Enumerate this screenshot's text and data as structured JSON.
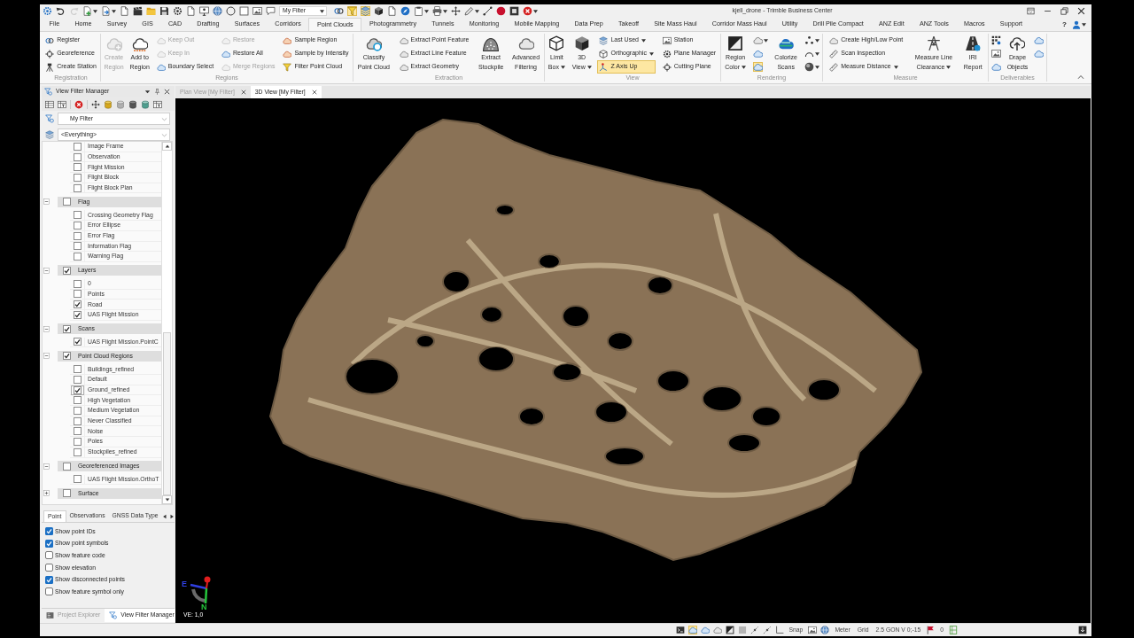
{
  "window": {
    "title": "kjell_drone - Trimble Business Center"
  },
  "quick_access": {
    "tools": [
      {
        "active": false,
        "disabled": false,
        "dropdown": false
      },
      {
        "active": false,
        "disabled": false,
        "dropdown": false
      },
      {
        "active": false,
        "disabled": true,
        "dropdown": false
      },
      {
        "active": false,
        "disabled": false,
        "dropdown": true
      },
      {
        "active": false,
        "disabled": false,
        "dropdown": true
      },
      {
        "active": false,
        "disabled": false,
        "dropdown": false
      },
      {
        "active": false,
        "disabled": false,
        "dropdown": false
      },
      {
        "active": false,
        "disabled": false,
        "dropdown": false
      },
      {
        "active": false,
        "disabled": false,
        "dropdown": false
      },
      {
        "active": false,
        "disabled": false,
        "dropdown": false
      },
      {
        "active": false,
        "disabled": false,
        "dropdown": false
      },
      {
        "active": false,
        "disabled": false,
        "dropdown": false
      },
      {
        "active": false,
        "disabled": false,
        "dropdown": false
      },
      {
        "active": false,
        "disabled": false,
        "dropdown": false
      },
      {
        "active": false,
        "disabled": false,
        "dropdown": false
      },
      {
        "active": false,
        "disabled": false,
        "dropdown": false
      },
      {
        "active": false,
        "disabled": false,
        "dropdown": false
      }
    ],
    "filter": {
      "value": "My Filter"
    },
    "tools_2": [
      {
        "active": false,
        "disabled": false,
        "dropdown": false
      },
      {
        "active": true,
        "disabled": false,
        "dropdown": false
      },
      {
        "active": true,
        "disabled": false,
        "dropdown": false
      },
      {
        "active": false,
        "disabled": false,
        "dropdown": false
      },
      {
        "active": false,
        "disabled": false,
        "dropdown": false
      },
      {
        "active": false,
        "disabled": false,
        "dropdown": false
      },
      {
        "active": false,
        "disabled": false,
        "dropdown": true
      },
      {
        "active": false,
        "disabled": false,
        "dropdown": true
      },
      {
        "active": false,
        "disabled": false,
        "dropdown": false
      },
      {
        "active": false,
        "disabled": false,
        "dropdown": true
      },
      {
        "active": false,
        "disabled": false,
        "dropdown": false
      },
      {
        "active": false,
        "disabled": false,
        "dropdown": false
      },
      {
        "active": false,
        "disabled": false,
        "dropdown": false
      },
      {
        "active": false,
        "disabled": false,
        "dropdown": true
      }
    ]
  },
  "ribbon": {
    "tabs": [
      {
        "label": "File",
        "selected": false
      },
      {
        "label": "Home",
        "selected": false
      },
      {
        "label": "Survey",
        "selected": false
      },
      {
        "label": "GIS",
        "selected": false
      },
      {
        "label": "CAD",
        "selected": false
      },
      {
        "label": "Drafting",
        "selected": false
      },
      {
        "label": "Surfaces",
        "selected": false
      },
      {
        "label": "Corridors",
        "selected": false
      },
      {
        "label": "Point Clouds",
        "selected": true
      },
      {
        "label": "Photogrammetry",
        "selected": false
      },
      {
        "label": "Tunnels",
        "selected": false
      },
      {
        "label": "Monitoring",
        "selected": false
      },
      {
        "label": "Mobile Mapping",
        "selected": false
      },
      {
        "label": "Data Prep",
        "selected": false
      },
      {
        "label": "Takeoff",
        "selected": false
      },
      {
        "label": "Site Mass Haul",
        "selected": false
      },
      {
        "label": "Corridor Mass Haul",
        "selected": false
      },
      {
        "label": "Utility",
        "selected": false
      },
      {
        "label": "Drill Pile Compact",
        "selected": false
      },
      {
        "label": "ANZ Edit",
        "selected": false
      },
      {
        "label": "ANZ Tools",
        "selected": false
      },
      {
        "label": "Macros",
        "selected": false
      },
      {
        "label": "Support",
        "selected": false
      }
    ],
    "help": "?",
    "groups": [
      {
        "label": "Registration",
        "columns": [
          {
            "kind": "stack",
            "items": [
              {
                "label": "Register",
                "disabled": false,
                "active": false,
                "dropdown": false
              },
              {
                "label": "Georeference",
                "disabled": false,
                "active": false,
                "dropdown": false
              },
              {
                "label": "Create Station",
                "disabled": false,
                "active": false,
                "dropdown": false
              }
            ]
          }
        ]
      },
      {
        "label": "Regions",
        "columns": [
          {
            "kind": "large",
            "items": [
              {
                "lines": [
                  "Create",
                  "Region"
                ],
                "disabled": true,
                "active": false,
                "dropdown": false
              }
            ]
          },
          {
            "kind": "large",
            "items": [
              {
                "lines": [
                  "Add to",
                  "Region"
                ],
                "disabled": false,
                "active": false,
                "dropdown": false
              }
            ]
          },
          {
            "kind": "stack",
            "items": [
              {
                "label": "Keep Out",
                "disabled": true,
                "active": false,
                "dropdown": false
              },
              {
                "label": "Keep In",
                "disabled": true,
                "active": false,
                "dropdown": false
              },
              {
                "label": "Boundary Select",
                "disabled": false,
                "active": false,
                "dropdown": false
              }
            ]
          },
          {
            "kind": "stack",
            "items": [
              {
                "label": "Restore",
                "disabled": true,
                "active": false,
                "dropdown": false
              },
              {
                "label": "Restore All",
                "disabled": false,
                "active": false,
                "dropdown": false
              },
              {
                "label": "Merge Regions",
                "disabled": true,
                "active": false,
                "dropdown": false
              }
            ]
          },
          {
            "kind": "stack",
            "items": [
              {
                "label": "Sample Region",
                "disabled": false,
                "active": false,
                "dropdown": false
              },
              {
                "label": "Sample by Intensity",
                "disabled": false,
                "active": false,
                "dropdown": false
              },
              {
                "label": "Filter Point Cloud",
                "disabled": false,
                "active": false,
                "dropdown": false
              }
            ]
          }
        ]
      },
      {
        "label": "Extraction",
        "columns": [
          {
            "kind": "large",
            "items": [
              {
                "lines": [
                  "Classify",
                  "Point Cloud"
                ],
                "disabled": false,
                "active": false,
                "dropdown": false
              }
            ]
          },
          {
            "kind": "stack",
            "items": [
              {
                "label": "Extract Point Feature",
                "disabled": false,
                "active": false,
                "dropdown": false
              },
              {
                "label": "Extract Line Feature",
                "disabled": false,
                "active": false,
                "dropdown": false
              },
              {
                "label": "Extract Geometry",
                "disabled": false,
                "active": false,
                "dropdown": false
              }
            ]
          },
          {
            "kind": "large",
            "items": [
              {
                "lines": [
                  "Extract",
                  "Stockpile"
                ],
                "disabled": false,
                "active": false,
                "dropdown": false
              }
            ]
          },
          {
            "kind": "large",
            "items": [
              {
                "lines": [
                  "Advanced",
                  "Filtering"
                ],
                "disabled": false,
                "active": false,
                "dropdown": false
              }
            ]
          }
        ]
      },
      {
        "label": "View",
        "columns": [
          {
            "kind": "large",
            "items": [
              {
                "lines": [
                  "Limit",
                  "Box"
                ],
                "disabled": false,
                "active": false,
                "dropdown": true
              }
            ]
          },
          {
            "kind": "large",
            "items": [
              {
                "lines": [
                  "3D",
                  "View"
                ],
                "disabled": false,
                "active": false,
                "dropdown": true
              }
            ]
          },
          {
            "kind": "stack",
            "items": [
              {
                "label": "Last Used",
                "disabled": false,
                "active": false,
                "dropdown": true
              },
              {
                "label": "Orthographic",
                "disabled": false,
                "active": false,
                "dropdown": true
              },
              {
                "label": "Z Axis Up",
                "disabled": false,
                "active": true,
                "dropdown": false
              }
            ]
          },
          {
            "kind": "stack",
            "items": [
              {
                "label": "Station",
                "disabled": false,
                "active": false,
                "dropdown": false
              },
              {
                "label": "Plane Manager",
                "disabled": false,
                "active": false,
                "dropdown": false
              },
              {
                "label": "Cutting Plane",
                "disabled": false,
                "active": false,
                "dropdown": false
              }
            ]
          }
        ]
      },
      {
        "label": "Rendering",
        "columns": [
          {
            "kind": "large",
            "items": [
              {
                "lines": [
                  "Region",
                  "Color"
                ],
                "disabled": false,
                "active": false,
                "dropdown": true
              }
            ]
          },
          {
            "kind": "icons",
            "items": [
              {
                "disabled": false,
                "active": false,
                "dropdown": true
              },
              {
                "disabled": false,
                "active": false,
                "dropdown": false
              },
              {
                "disabled": false,
                "active": true,
                "dropdown": false
              }
            ]
          },
          {
            "kind": "large",
            "items": [
              {
                "lines": [
                  "Colorize",
                  "Scans"
                ],
                "disabled": false,
                "active": false,
                "dropdown": false
              }
            ]
          },
          {
            "kind": "icons",
            "items": [
              {
                "disabled": false,
                "active": false,
                "dropdown": true
              },
              {
                "disabled": false,
                "active": false,
                "dropdown": true
              },
              {
                "disabled": false,
                "active": false,
                "dropdown": true
              }
            ]
          }
        ]
      },
      {
        "label": "Measure",
        "columns": [
          {
            "kind": "stack",
            "items": [
              {
                "label": "Create High/Low Point",
                "disabled": false,
                "active": false,
                "dropdown": false
              },
              {
                "label": "Scan Inspection",
                "disabled": false,
                "active": false,
                "dropdown": false
              },
              {
                "label": "Measure Distance",
                "disabled": false,
                "active": false,
                "dropdown": true
              }
            ]
          },
          {
            "kind": "large",
            "items": [
              {
                "lines": [
                  "Measure Line",
                  "Clearance"
                ],
                "disabled": false,
                "active": false,
                "dropdown": true
              }
            ]
          },
          {
            "kind": "large",
            "items": [
              {
                "lines": [
                  "IRI",
                  "Report"
                ],
                "disabled": false,
                "active": false,
                "dropdown": false
              }
            ]
          }
        ]
      },
      {
        "label": "Deliverables",
        "columns": [
          {
            "kind": "icons",
            "items": [
              {
                "disabled": false,
                "active": false,
                "dropdown": false
              },
              {
                "disabled": false,
                "active": false,
                "dropdown": false
              },
              {
                "disabled": false,
                "active": false,
                "dropdown": false
              }
            ]
          },
          {
            "kind": "large",
            "items": [
              {
                "lines": [
                  "Drape",
                  "Objects"
                ],
                "disabled": false,
                "active": false,
                "dropdown": false
              }
            ]
          },
          {
            "kind": "icons",
            "items": [
              {
                "disabled": false,
                "active": false,
                "dropdown": false
              },
              {
                "disabled": false,
                "active": false,
                "dropdown": false
              }
            ]
          }
        ]
      }
    ]
  },
  "left_panel": {
    "title": "View Filter Manager",
    "filter": {
      "value": "My Filter"
    },
    "scope": {
      "value": "<Everything>"
    },
    "tree": [
      {
        "children": [
          {
            "label": "Image Frame",
            "checked": false,
            "focused": false
          },
          {
            "label": "Observation",
            "checked": false,
            "focused": false
          },
          {
            "label": "Flight Mission",
            "checked": false,
            "focused": false
          },
          {
            "label": "Flight Block",
            "checked": false,
            "focused": false
          },
          {
            "label": "Flight Block Plan",
            "checked": false,
            "focused": false
          }
        ]
      },
      {
        "label": "Flag",
        "checked": false,
        "expanded": true,
        "children": [
          {
            "label": "Crossing Geometry Flag",
            "checked": false,
            "focused": false
          },
          {
            "label": "Error Ellipse",
            "checked": false,
            "focused": false
          },
          {
            "label": "Error Flag",
            "checked": false,
            "focused": false
          },
          {
            "label": "Information Flag",
            "checked": false,
            "focused": false
          },
          {
            "label": "Warning Flag",
            "checked": false,
            "focused": false
          }
        ]
      },
      {
        "label": "Layers",
        "checked": true,
        "expanded": true,
        "children": [
          {
            "label": "0",
            "checked": false,
            "focused": false
          },
          {
            "label": "Points",
            "checked": false,
            "focused": false
          },
          {
            "label": "Road",
            "checked": true,
            "focused": false
          },
          {
            "label": "UAS Flight Mission",
            "checked": true,
            "focused": false
          }
        ]
      },
      {
        "label": "Scans",
        "checked": true,
        "expanded": true,
        "children": [
          {
            "label": "UAS Flight Mission.PointC",
            "checked": true,
            "focused": false
          }
        ]
      },
      {
        "label": "Point Cloud Regions",
        "checked": true,
        "expanded": true,
        "children": [
          {
            "label": "Buildings_refined",
            "checked": false,
            "focused": false
          },
          {
            "label": "Default",
            "checked": false,
            "focused": false
          },
          {
            "label": "Ground_refined",
            "checked": true,
            "focused": true
          },
          {
            "label": "High Vegetation",
            "checked": false,
            "focused": false
          },
          {
            "label": "Medium Vegetation",
            "checked": false,
            "focused": false
          },
          {
            "label": "Never Classified",
            "checked": false,
            "focused": false
          },
          {
            "label": "Noise",
            "checked": false,
            "focused": false
          },
          {
            "label": "Poles",
            "checked": false,
            "focused": false
          },
          {
            "label": "Stockpiles_refined",
            "checked": false,
            "focused": false
          }
        ]
      },
      {
        "label": "Georeferenced Images",
        "checked": false,
        "expanded": true,
        "children": [
          {
            "label": "UAS Flight Mission.OrthoT",
            "checked": false,
            "focused": false
          }
        ]
      },
      {
        "label": "Surface",
        "checked": false,
        "expanded": false
      }
    ],
    "tabs": [
      {
        "label": "Point",
        "selected": true
      },
      {
        "label": "Observations",
        "selected": false
      },
      {
        "label": "GNSS Data Type",
        "selected": false
      }
    ],
    "options": [
      {
        "label": "Show point IDs",
        "checked": true
      },
      {
        "label": "Show point symbols",
        "checked": true
      },
      {
        "label": "Show feature code",
        "checked": false
      },
      {
        "label": "Show elevation",
        "checked": false
      },
      {
        "label": "Show disconnected points",
        "checked": true
      },
      {
        "label": "Show feature symbol only",
        "checked": false
      }
    ],
    "bottom_tabs": [
      {
        "label": "Project Explorer",
        "selected": false
      },
      {
        "label": "View Filter Manager",
        "selected": true
      }
    ]
  },
  "view": {
    "tabs": [
      {
        "label": "Plan View [My Filter]",
        "selected": false
      },
      {
        "label": "3D View [My Filter]",
        "selected": true
      }
    ],
    "axes": [
      {
        "label": "E",
        "color": "#2f3fe0"
      },
      {
        "label": "N",
        "color": "#25c53c"
      }
    ],
    "exaggeration": "VE: 1,0"
  },
  "status_bar": {
    "items": [
      {
        "kind": "tool",
        "active": false
      },
      {
        "kind": "tool",
        "active": true
      },
      {
        "kind": "tool",
        "active": false
      },
      {
        "kind": "tool",
        "active": false
      },
      {
        "kind": "tool",
        "active": false
      },
      {
        "kind": "tool",
        "active": false
      },
      {
        "kind": "tool",
        "active": false
      },
      {
        "kind": "tool",
        "active": false
      },
      {
        "kind": "tool",
        "active": false
      },
      {
        "kind": "text",
        "text": "Snap",
        "active": false
      },
      {
        "kind": "tool",
        "active": false
      },
      {
        "kind": "tool",
        "active": false
      },
      {
        "kind": "text",
        "text": "Meter",
        "active": false
      },
      {
        "kind": "text",
        "text": "Grid",
        "active": false
      },
      {
        "kind": "text",
        "text": "2.5 GON V 0;-15",
        "active": false
      },
      {
        "kind": "tool",
        "active": false
      },
      {
        "kind": "text",
        "text": "0",
        "active": false
      },
      {
        "kind": "tool",
        "active": false
      }
    ]
  }
}
